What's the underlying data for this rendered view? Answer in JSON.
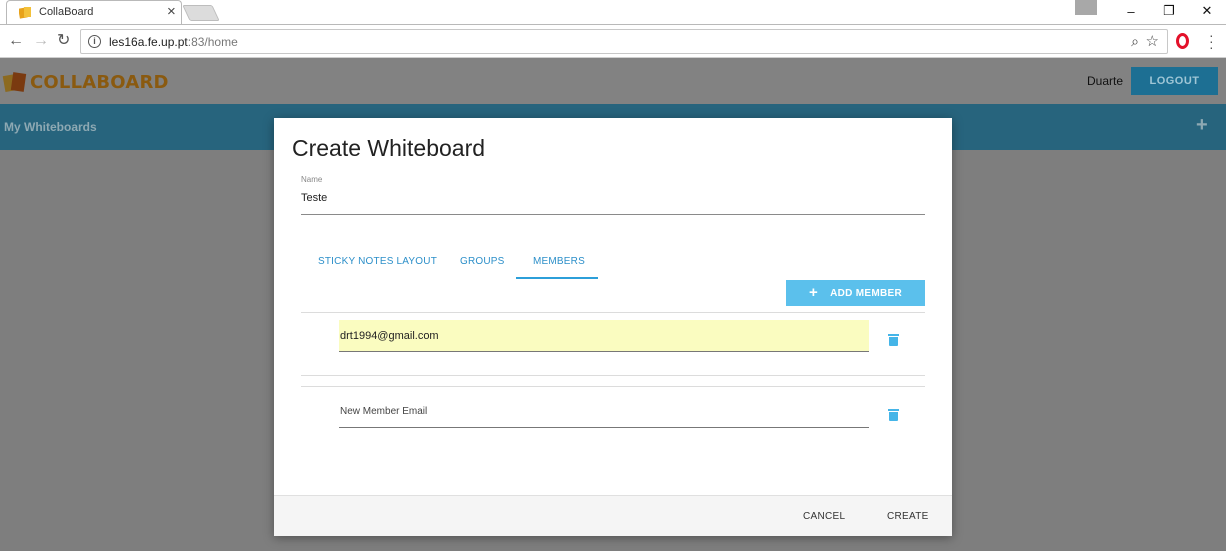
{
  "browser": {
    "tab_title": "CollaBoard",
    "tab_close": "×",
    "url_host": "les16a.fe.up.pt",
    "url_path": ":83/home",
    "window_controls": [
      "–",
      "❐",
      "✕"
    ]
  },
  "app": {
    "logo_text": "COLLABOARD",
    "user_name": "Duarte",
    "logout_label": "LOGOUT",
    "section_title": "My Whiteboards",
    "add_label": "+"
  },
  "dialog": {
    "title": "Create Whiteboard",
    "name_label": "Name",
    "name_value": "Teste",
    "tabs": [
      {
        "label": "STICKY NOTES LAYOUT",
        "active": false
      },
      {
        "label": "GROUPS",
        "active": false
      },
      {
        "label": "MEMBERS",
        "active": true
      }
    ],
    "add_member_label": "ADD MEMBER",
    "members": [
      {
        "email": "drt1994@gmail.com"
      }
    ],
    "new_member_placeholder": "New Member Email",
    "cancel_label": "CANCEL",
    "create_label": "CREATE"
  },
  "colors": {
    "accent": "#5bc0ec",
    "tab_blue": "#2c8fc9",
    "autofill": "#fafcc0"
  }
}
